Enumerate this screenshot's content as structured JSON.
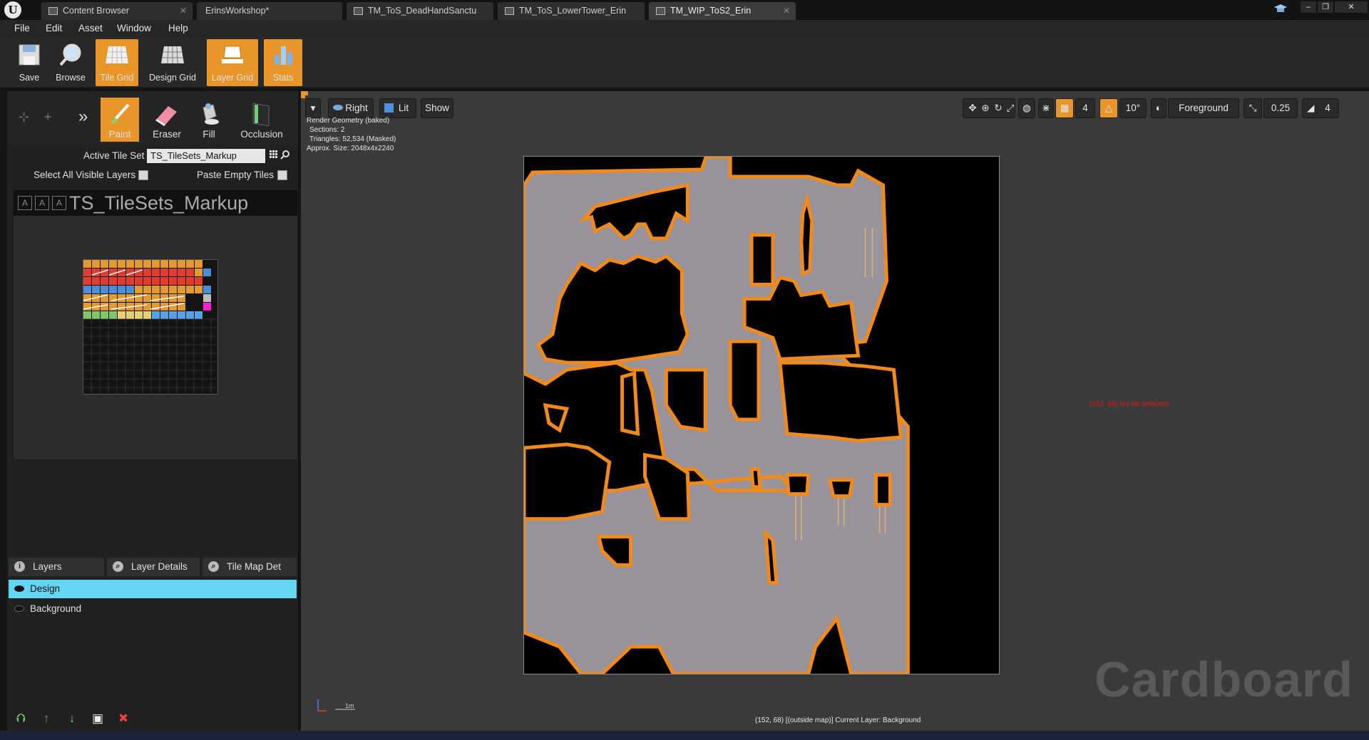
{
  "tabs": [
    {
      "label": "Content Browser",
      "active": false
    },
    {
      "label": "ErinsWorkshop*",
      "active": false
    },
    {
      "label": "TM_ToS_DeadHandSanctu",
      "active": false
    },
    {
      "label": "TM_ToS_LowerTower_Erin",
      "active": false
    },
    {
      "label": "TM_WIP_ToS2_Erin",
      "active": true
    }
  ],
  "window_buttons": [
    "–",
    "❐",
    "✕"
  ],
  "menu": [
    "File",
    "Edit",
    "Asset",
    "Window",
    "Help"
  ],
  "toolbar": {
    "save": "Save",
    "browse": "Browse",
    "tile_grid": "Tile Grid",
    "design_grid": "Design Grid",
    "layer_grid": "Layer Grid",
    "stats": "Stats"
  },
  "modes": {
    "paint": "Paint",
    "eraser": "Eraser",
    "fill": "Fill",
    "occlusion": "Occlusion"
  },
  "tile_set": {
    "label": "Active Tile Set",
    "value": "TS_TileSets_Markup",
    "viewer_title": "TS_TileSets_Markup"
  },
  "options": {
    "select_all": "Select All Visible Layers",
    "paste_empty": "Paste Empty Tiles"
  },
  "layer_tabs": [
    "Layers",
    "Layer Details",
    "Tile Map Det"
  ],
  "layers": [
    {
      "name": "Design",
      "selected": true
    },
    {
      "name": "Background",
      "selected": false
    }
  ],
  "viewport": {
    "view_mode": "Right",
    "lit": "Lit",
    "show": "Show",
    "grid_value": "4",
    "angle_value": "10°",
    "foreground": "Foreground",
    "scale_value": "0.25",
    "camera_speed": "4",
    "stats": [
      "Render Geometry (baked)",
      "Sections: 2",
      "Triangles: 52,534 (Masked)",
      "Approx. Size: 2048x4x2240"
    ],
    "cursor_info": "(152, 68) No tile selected",
    "status": "(152, 68) [(outside map)]   Current Layer: Background",
    "scale_label": "1m",
    "watermark": "Cardboard"
  },
  "colors": {
    "accent": "#e8962a",
    "selection": "#63d6f2",
    "floor": "#99939b",
    "wall": "#010101",
    "edge": "#f08a1a"
  }
}
